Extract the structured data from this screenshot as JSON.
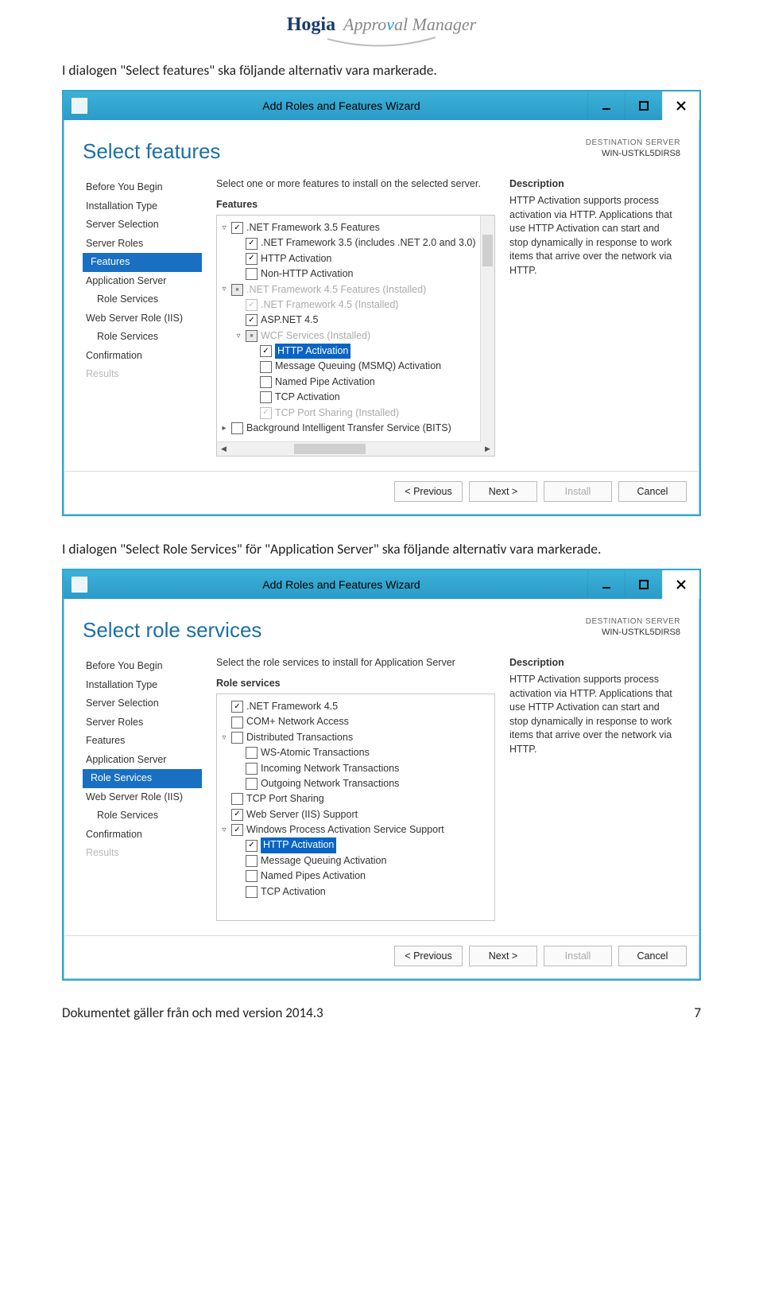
{
  "logo": {
    "brand": "Hogia",
    "product_pre": "Appro",
    "product_v": "v",
    "product_post": "al Manager"
  },
  "doc": {
    "p1": "I dialogen \"Select features\" ska följande alternativ vara markerade.",
    "p2": "I dialogen \"Select Role Services\" för \"Application Server\" ska följande alternativ vara markerade.",
    "footer_left": "Dokumentet gäller från och med version 2014.3",
    "footer_right": "7"
  },
  "common": {
    "title": "Add Roles and Features Wizard",
    "dest_label": "DESTINATION SERVER",
    "dest_server": "WIN-USTKL5DIRS8",
    "desc_header": "Description",
    "desc_body": "HTTP Activation supports process activation via HTTP. Applications that use HTTP Activation can start and stop dynamically in response to work items that arrive over the network via HTTP.",
    "btn_prev": "< Previous",
    "btn_next": "Next >",
    "btn_install": "Install",
    "btn_cancel": "Cancel"
  },
  "win1": {
    "page_title": "Select features",
    "instr": "Select one or more features to install on the selected server.",
    "section": "Features",
    "nav": [
      "Before You Begin",
      "Installation Type",
      "Server Selection",
      "Server Roles",
      "Features",
      "Application Server",
      "Role Services",
      "Web Server Role (IIS)",
      "Role Services",
      "Confirmation",
      "Results"
    ],
    "nav_selected": 4,
    "nav_sub": [
      6,
      8
    ],
    "nav_disabled": [
      10
    ],
    "tree": [
      {
        "ind": 0,
        "exp": "▿",
        "cb": "checked",
        "label": ".NET Framework 3.5 Features"
      },
      {
        "ind": 1,
        "exp": "",
        "cb": "checked",
        "label": ".NET Framework 3.5 (includes .NET 2.0 and 3.0)"
      },
      {
        "ind": 1,
        "exp": "",
        "cb": "checked",
        "label": "HTTP Activation"
      },
      {
        "ind": 1,
        "exp": "",
        "cb": "",
        "label": "Non-HTTP Activation"
      },
      {
        "ind": 0,
        "exp": "▿",
        "cb": "mixed",
        "label": ".NET Framework 4.5 Features (Installed)",
        "dis": true
      },
      {
        "ind": 1,
        "exp": "",
        "cb": "checked dis",
        "label": ".NET Framework 4.5 (Installed)",
        "dis": true
      },
      {
        "ind": 1,
        "exp": "",
        "cb": "checked",
        "label": "ASP.NET 4.5"
      },
      {
        "ind": 1,
        "exp": "▿",
        "cb": "mixed",
        "label": "WCF Services (Installed)",
        "dis": true
      },
      {
        "ind": 2,
        "exp": "",
        "cb": "checked",
        "label": "HTTP Activation",
        "sel": true
      },
      {
        "ind": 2,
        "exp": "",
        "cb": "",
        "label": "Message Queuing (MSMQ) Activation"
      },
      {
        "ind": 2,
        "exp": "",
        "cb": "",
        "label": "Named Pipe Activation"
      },
      {
        "ind": 2,
        "exp": "",
        "cb": "",
        "label": "TCP Activation"
      },
      {
        "ind": 2,
        "exp": "",
        "cb": "checked dis",
        "label": "TCP Port Sharing (Installed)",
        "dis": true
      },
      {
        "ind": 0,
        "exp": "▸",
        "cb": "",
        "label": "Background Intelligent Transfer Service (BITS)"
      }
    ]
  },
  "win2": {
    "page_title": "Select role services",
    "instr": "Select the role services to install for Application Server",
    "section": "Role services",
    "nav": [
      "Before You Begin",
      "Installation Type",
      "Server Selection",
      "Server Roles",
      "Features",
      "Application Server",
      "Role Services",
      "Web Server Role (IIS)",
      "Role Services",
      "Confirmation",
      "Results"
    ],
    "nav_selected": 6,
    "nav_sub": [
      6,
      8
    ],
    "nav_disabled": [
      10
    ],
    "tree": [
      {
        "ind": 0,
        "exp": "",
        "cb": "checked",
        "label": ".NET Framework 4.5"
      },
      {
        "ind": 0,
        "exp": "",
        "cb": "",
        "label": "COM+ Network Access"
      },
      {
        "ind": 0,
        "exp": "▿",
        "cb": "",
        "label": "Distributed Transactions"
      },
      {
        "ind": 1,
        "exp": "",
        "cb": "",
        "label": "WS-Atomic Transactions"
      },
      {
        "ind": 1,
        "exp": "",
        "cb": "",
        "label": "Incoming Network Transactions"
      },
      {
        "ind": 1,
        "exp": "",
        "cb": "",
        "label": "Outgoing Network Transactions"
      },
      {
        "ind": 0,
        "exp": "",
        "cb": "",
        "label": "TCP Port Sharing"
      },
      {
        "ind": 0,
        "exp": "",
        "cb": "checked",
        "label": "Web Server (IIS) Support"
      },
      {
        "ind": 0,
        "exp": "▿",
        "cb": "checked",
        "label": "Windows Process Activation Service Support"
      },
      {
        "ind": 1,
        "exp": "",
        "cb": "checked",
        "label": "HTTP Activation",
        "sel": true
      },
      {
        "ind": 1,
        "exp": "",
        "cb": "",
        "label": "Message Queuing Activation"
      },
      {
        "ind": 1,
        "exp": "",
        "cb": "",
        "label": "Named Pipes Activation"
      },
      {
        "ind": 1,
        "exp": "",
        "cb": "",
        "label": "TCP Activation"
      }
    ]
  }
}
